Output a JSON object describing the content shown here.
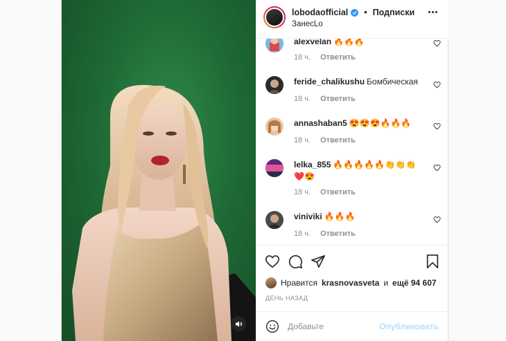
{
  "post": {
    "author": "lobodaofficial",
    "follow_label": "Подписки",
    "subtitle": "ЗанесLo",
    "video_sound_icon": "speaker-icon"
  },
  "comments": [
    {
      "username": "alexvelan",
      "text": "🔥🔥🔥",
      "time": "18 ч.",
      "reply": "Ответить"
    },
    {
      "username": "feride_chalikushu",
      "text": "Бомбическая",
      "time": "18 ч.",
      "reply": "Ответить"
    },
    {
      "username": "annashaban5",
      "text": "😍😍😍🔥🔥🔥",
      "time": "18 ч.",
      "reply": "Ответить"
    },
    {
      "username": "lelka_855",
      "text": "🔥🔥🔥🔥🔥👏👏👏❤️😍",
      "time": "18 ч.",
      "reply": "Ответить"
    },
    {
      "username": "viniviki",
      "text": "🔥🔥🔥",
      "time": "18 ч.",
      "reply": "Ответить"
    }
  ],
  "likes": {
    "prefix": "Нравится",
    "user": "krasnovasveta",
    "conj": "и",
    "rest": "ещё 94 607"
  },
  "date": "ДЕНЬ НАЗАД",
  "add_comment": {
    "placeholder": "Добавьте",
    "publish": "Опубликовать"
  },
  "colors": {
    "accent": "#3897f0",
    "publish_disabled": "#b2dffc",
    "like_red": "#ed4956"
  }
}
